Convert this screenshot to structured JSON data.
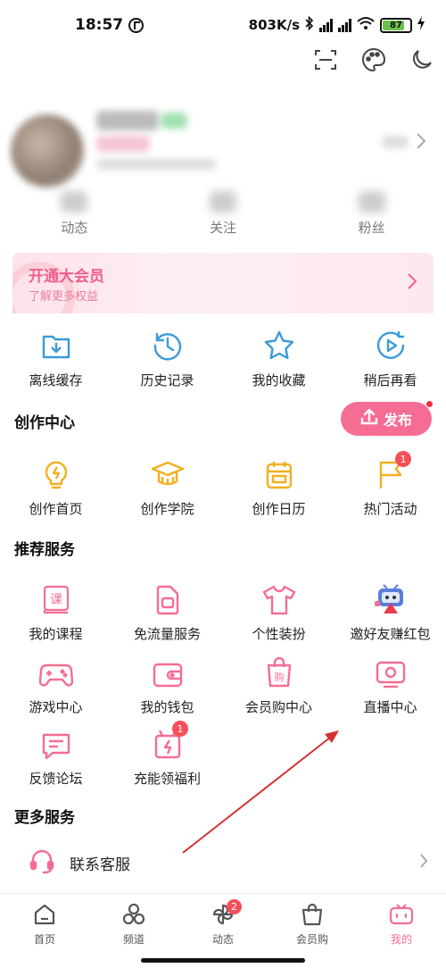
{
  "status_bar": {
    "time": "18:57",
    "speed": "803K/s",
    "battery": "87"
  },
  "stats": [
    {
      "label": "动态"
    },
    {
      "label": "关注"
    },
    {
      "label": "粉丝"
    }
  ],
  "vip": {
    "title": "开通大会员",
    "subtitle": "了解更多权益"
  },
  "quick_actions": [
    {
      "label": "离线缓存",
      "icon": "download-box-icon"
    },
    {
      "label": "历史记录",
      "icon": "history-clock-icon"
    },
    {
      "label": "我的收藏",
      "icon": "star-icon"
    },
    {
      "label": "稍后再看",
      "icon": "play-later-icon"
    }
  ],
  "creation": {
    "title": "创作中心",
    "publish_label": "发布",
    "items": [
      {
        "label": "创作首页",
        "icon": "lightbulb-icon"
      },
      {
        "label": "创作学院",
        "icon": "graduation-cap-icon"
      },
      {
        "label": "创作日历",
        "icon": "calendar-icon"
      },
      {
        "label": "热门活动",
        "icon": "flag-icon",
        "badge": "1"
      }
    ]
  },
  "recommended": {
    "title": "推荐服务",
    "items": [
      {
        "label": "我的课程",
        "icon": "course-book-icon"
      },
      {
        "label": "免流量服务",
        "icon": "sim-card-icon"
      },
      {
        "label": "个性装扮",
        "icon": "tshirt-icon"
      },
      {
        "label": "邀好友赚红包",
        "icon": "mascot-icon"
      },
      {
        "label": "游戏中心",
        "icon": "gamepad-icon"
      },
      {
        "label": "我的钱包",
        "icon": "wallet-icon"
      },
      {
        "label": "会员购中心",
        "icon": "shopping-bag-icon"
      },
      {
        "label": "直播中心",
        "icon": "tv-icon"
      },
      {
        "label": "反馈论坛",
        "icon": "chat-bubble-icon"
      },
      {
        "label": "充能领福利",
        "icon": "gift-charge-icon",
        "badge": "1"
      }
    ]
  },
  "more": {
    "title": "更多服务",
    "items": [
      {
        "label": "联系客服",
        "icon": "headset-icon"
      }
    ]
  },
  "bottom_nav": [
    {
      "label": "首页",
      "icon": "home-icon"
    },
    {
      "label": "频道",
      "icon": "channel-circles-icon"
    },
    {
      "label": "动态",
      "icon": "pinwheel-icon",
      "badge": "2"
    },
    {
      "label": "会员购",
      "icon": "shop-bag-icon"
    },
    {
      "label": "我的",
      "icon": "tv-mascot-icon",
      "active": true
    }
  ],
  "colors": {
    "accent": "#f56d93",
    "blue": "#3a9bd9",
    "yellow": "#f2b01e",
    "badge": "#f5505a",
    "annotation_arrow": "#d23232"
  }
}
